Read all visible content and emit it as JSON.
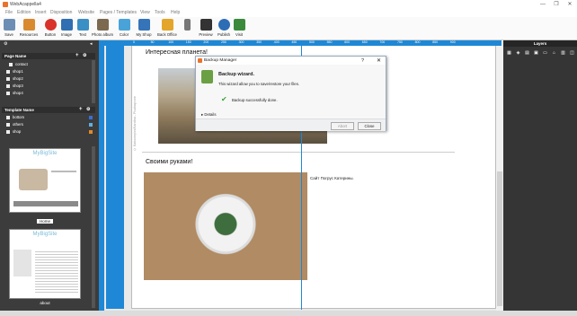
{
  "app": {
    "title": "WebAcappella4"
  },
  "window": {
    "minimize": "—",
    "restore": "❐",
    "close": "✕"
  },
  "menu": [
    "File",
    "Edition",
    "Insert",
    "Disposition",
    "Website",
    "Pages / Templates",
    "View",
    "Tools",
    "Help"
  ],
  "toolbar": [
    {
      "label": "Save",
      "color": "#6c8eb4"
    },
    {
      "label": "Resources",
      "color": "#d98a2f"
    },
    {
      "label": "Button",
      "color": "#d8322a"
    },
    {
      "label": "Image",
      "color": "#2f6fb2"
    },
    {
      "label": "Text",
      "color": "#3a8fc4"
    },
    {
      "label": "Photo album",
      "color": "#7b6a50"
    },
    {
      "label": "Color",
      "color": "#4aa3d8"
    },
    {
      "label": "My Shop",
      "color": "#3574b8"
    },
    {
      "label": "Back Office",
      "color": "#e3a52a"
    },
    {
      "label": "",
      "color": "#777"
    },
    {
      "label": "Preview",
      "color": "#333"
    },
    {
      "label": "Publish",
      "color": "#2d6db5"
    },
    {
      "label": "Visit",
      "color": "#3b8a3b"
    }
  ],
  "pages_panel": {
    "header": "Page Name",
    "items": [
      "contact",
      "shop1",
      "shop2",
      "shop3",
      "shop4"
    ]
  },
  "templates_panel": {
    "header": "Template Name",
    "items": [
      {
        "label": "bottom",
        "chip": "#3a6fd0"
      },
      {
        "label": "others",
        "chip": "#5fb0e0"
      },
      {
        "label": "shop",
        "chip": "#e0892a"
      }
    ]
  },
  "thumbnails": [
    {
      "brand": "MyBigSite",
      "label": "Home"
    },
    {
      "brand": "MyBigSite",
      "label": "about"
    }
  ],
  "ruler_ticks": [
    "0",
    "50",
    "100",
    "150",
    "200",
    "250",
    "300",
    "350",
    "400",
    "450",
    "500",
    "550",
    "600",
    "650",
    "700",
    "750",
    "800",
    "850",
    "900"
  ],
  "canvas": {
    "heading1": "Интересная планета!",
    "heading2": "Своими руками!",
    "vertical_credit": "© Kaboompics/Karolina - Pixabay.com",
    "caption": "Сайт Погрус Катерины."
  },
  "layers": {
    "header": "Layers",
    "icons": [
      "▦",
      "◈",
      "▤",
      "▣",
      "▭",
      "⌂",
      "▥",
      "◫"
    ]
  },
  "dialog": {
    "title": "Backup Manager",
    "help": "?",
    "close": "✕",
    "wizard_title": "Backup wizard.",
    "wizard_desc": "This wizard allow you to save/restore your files.",
    "status": "Backup successfully done.",
    "details": "Details",
    "abort": "Abort",
    "close_btn": "Close"
  }
}
